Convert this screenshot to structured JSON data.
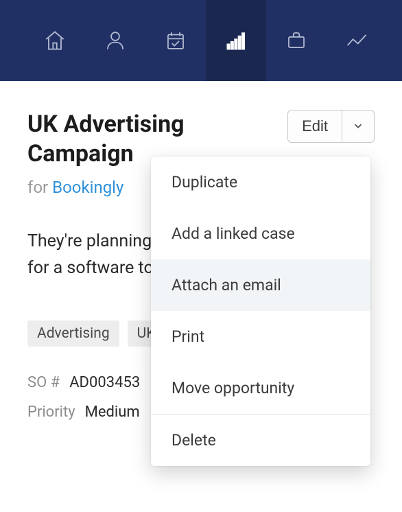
{
  "nav": {
    "items": [
      {
        "name": "home-icon"
      },
      {
        "name": "person-icon"
      },
      {
        "name": "calendar-check-icon"
      },
      {
        "name": "bars-icon",
        "active": true
      },
      {
        "name": "briefcase-icon"
      },
      {
        "name": "trend-icon"
      }
    ]
  },
  "header": {
    "title": "UK Advertising Campaign",
    "edit_label": "Edit",
    "for_prefix": "for",
    "company": "Bookingly"
  },
  "description": "They're planning on expanding and looking for a software tool like ours",
  "tags": [
    "Advertising",
    "UK"
  ],
  "meta": {
    "so_label": "SO #",
    "so_value": "AD003453",
    "priority_label": "Priority",
    "priority_value": "Medium"
  },
  "menu": {
    "items": [
      {
        "label": "Duplicate",
        "name": "menu-duplicate"
      },
      {
        "label": "Add a linked case",
        "name": "menu-add-linked-case"
      },
      {
        "label": "Attach an email",
        "name": "menu-attach-email",
        "highlight": true
      },
      {
        "label": "Print",
        "name": "menu-print"
      },
      {
        "label": "Move opportunity",
        "name": "menu-move-opportunity"
      },
      {
        "label": "Delete",
        "name": "menu-delete",
        "separated": true
      }
    ]
  }
}
